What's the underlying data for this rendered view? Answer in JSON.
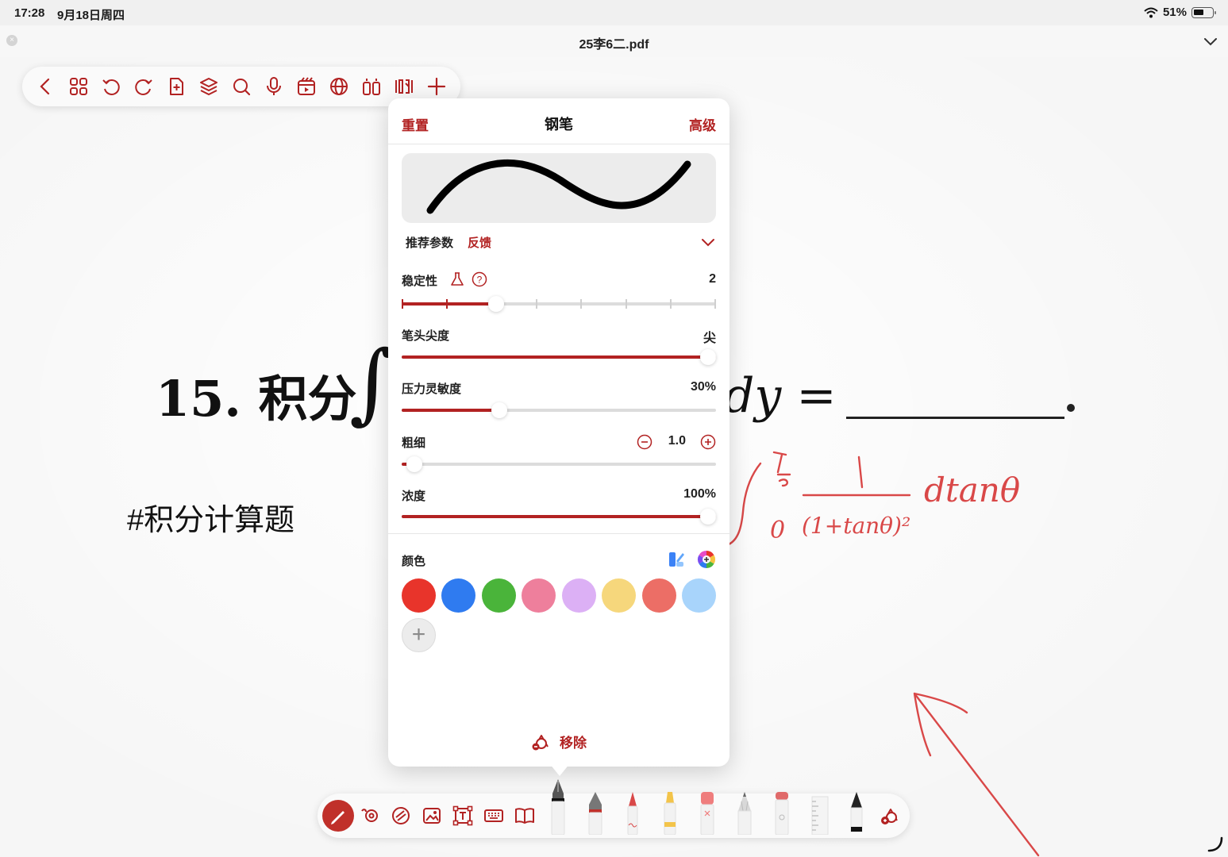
{
  "status_bar": {
    "time": "17:28",
    "date": "9月18日周四",
    "battery": "51%"
  },
  "title_bar": {
    "document_title": "25李6二.pdf"
  },
  "top_toolbar": {
    "icons": [
      "back-icon",
      "grid-icon",
      "undo-icon",
      "redo-icon",
      "add-page-icon",
      "layers-icon",
      "search-icon",
      "microphone-icon",
      "clip-icon",
      "globe-icon",
      "book-split-icon",
      "two-page-icon",
      "add-icon"
    ]
  },
  "page": {
    "problem_number": "15.",
    "problem_text": "积分",
    "problem_tail": "dy =",
    "hashtag": "#积分计算题",
    "handwriting": {
      "integral_upper": "π/2",
      "integral_lower": "0",
      "numerator": "1",
      "denominator": "(1+tanθ)²",
      "differential": "dtanθ"
    }
  },
  "pen_popover": {
    "reset_label": "重置",
    "title": "钢笔",
    "advanced_label": "高级",
    "recommended_label": "推荐参数",
    "feedback_label": "反馈",
    "settings": {
      "stability": {
        "label": "稳定性",
        "value": "2",
        "level": 0.29
      },
      "tip_sharpness": {
        "label": "笔头尖度",
        "value": "尖",
        "level": 1.0
      },
      "pressure": {
        "label": "压力灵敏度",
        "value": "30%",
        "level": 0.3
      },
      "thickness": {
        "label": "粗细",
        "value": "1.0",
        "level": 0.03
      },
      "opacity": {
        "label": "浓度",
        "value": "100%",
        "level": 1.0
      }
    },
    "color_label": "颜色",
    "swatches": [
      "#e8342b",
      "#2f7bf0",
      "#4ab43a",
      "#ee7f9c",
      "#dcb0f5",
      "#f6d77c",
      "#ec6e66",
      "#a8d4fb"
    ],
    "remove_label": "移除"
  },
  "bottom_toolbar": {
    "tools": [
      "pen-tool-icon",
      "lasso-icon",
      "sticker-icon",
      "image-icon",
      "text-box-icon",
      "keyboard-icon",
      "book-icon"
    ],
    "pens": [
      "fountain-pen",
      "calligraphy-pen",
      "fineliner",
      "highlighter",
      "eraser",
      "pencil",
      "marker",
      "ruler",
      "brush-pen"
    ],
    "active_tool": "pen-tool-icon",
    "selected_pen": "fountain-pen"
  },
  "colors": {
    "accent": "#b22222",
    "ink": "#d94848"
  }
}
